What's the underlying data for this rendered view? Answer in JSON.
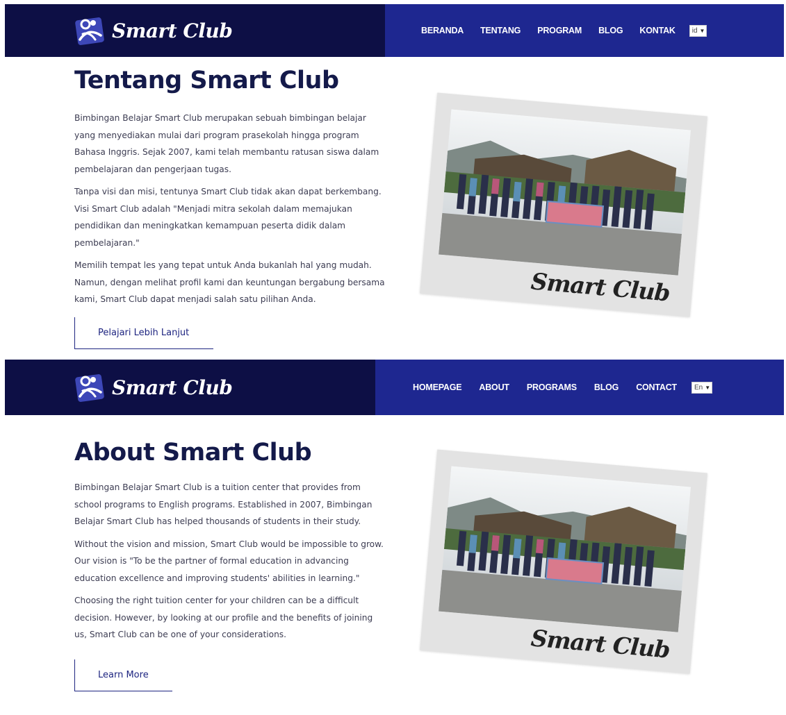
{
  "sections": {
    "id": {
      "brand": "Smart Club",
      "nav": [
        "BERANDA",
        "TENTANG",
        "PROGRAM",
        "BLOG",
        "KONTAK"
      ],
      "lang": "id",
      "title": "Tentang Smart Club",
      "paragraphs": [
        "Bimbingan Belajar Smart Club merupakan sebuah bimbingan belajar yang menyediakan mulai dari program prasekolah hingga program Bahasa Inggris. Sejak 2007, kami telah membantu ratusan siswa dalam pembelajaran dan pengerjaan tugas.",
        "Tanpa visi dan misi, tentunya Smart Club tidak akan dapat berkembang. Visi Smart Club adalah \"Menjadi mitra sekolah dalam memajukan pendidikan dan meningkatkan kemampuan peserta didik dalam pembelajaran.\"",
        "Memilih tempat les yang tepat untuk Anda bukanlah hal yang mudah. Namun, dengan melihat profil kami dan keuntungan bergabung bersama kami, Smart Club dapat menjadi salah satu pilihan Anda."
      ],
      "cta": "Pelajari Lebih Lanjut",
      "photo_caption": "Smart Club"
    },
    "en": {
      "brand": "Smart Club",
      "nav": [
        "HOMEPAGE",
        "ABOUT",
        "PROGRAMS",
        "BLOG",
        "CONTACT"
      ],
      "lang": "En",
      "title": "About Smart Club",
      "paragraphs": [
        "Bimbingan Belajar Smart Club is a tuition center that provides from school programs to English programs. Established in 2007, Bimbingan Belajar Smart Club has helped thousands of students in their study.",
        "Without the vision and mission, Smart Club would be impossible to grow. Our vision is \"To be the partner of formal education in advancing education excellence and improving students' abilities in learning.\"",
        "Choosing the right tuition center for your children can be a difficult decision. However, by looking at our profile and the benefits of joining us, Smart Club can be one of your considerations."
      ],
      "cta": "Learn More",
      "photo_caption": "Smart Club"
    }
  },
  "colors": {
    "nav_dark": "#0d0f45",
    "nav_blue": "#1e2790",
    "title": "#141a4a",
    "accent": "#1d2480"
  },
  "icons": [
    "smart-club-logo-mark",
    "chevron-down-icon"
  ]
}
